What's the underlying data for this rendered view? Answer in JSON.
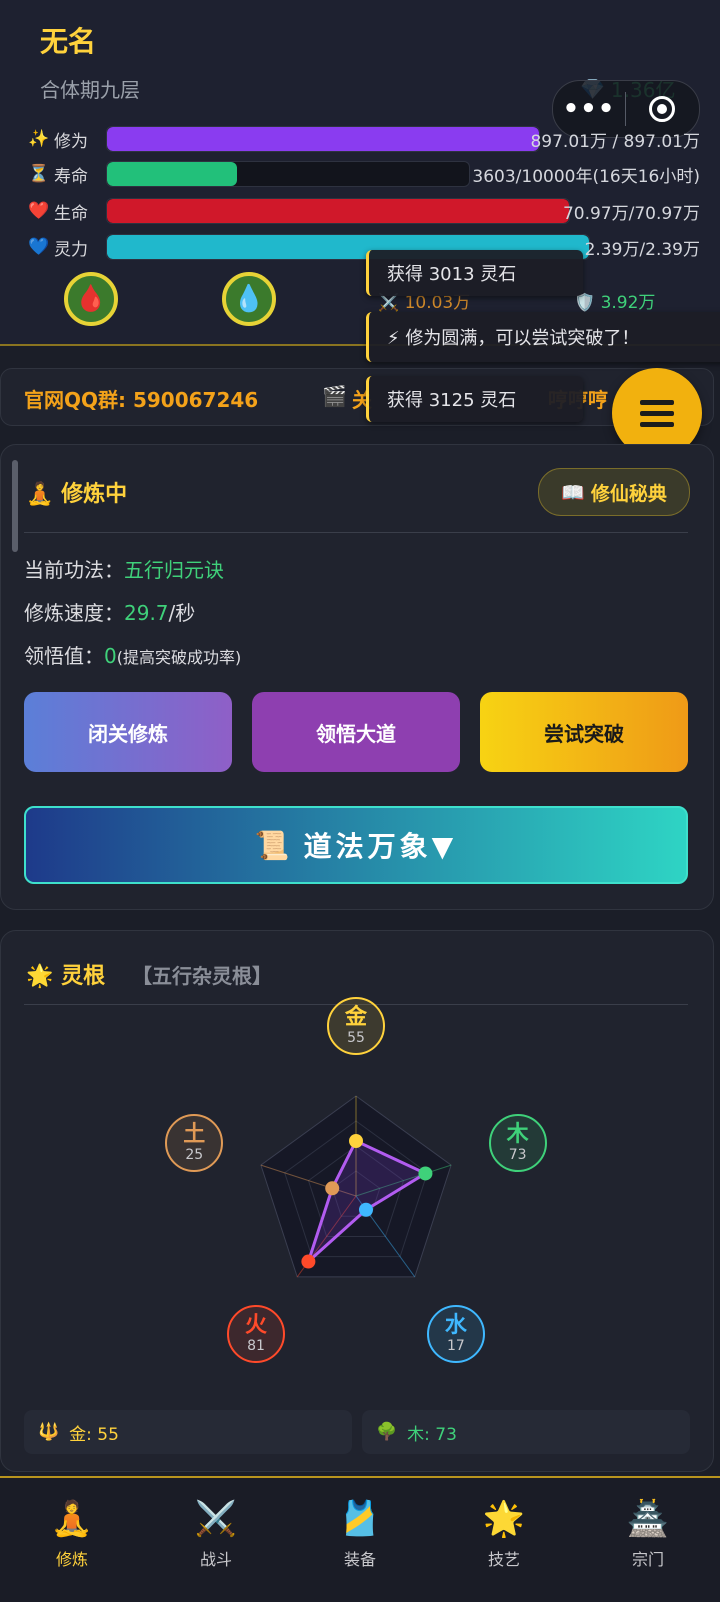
{
  "player": {
    "name": "无名",
    "realm": "合体期九层",
    "spirit_stones": "1.36亿"
  },
  "stats": [
    {
      "icon": "✨",
      "label": "修为",
      "value": "897.01万 / 897.01万",
      "fill": 1.0,
      "color": "#8a3cf0"
    },
    {
      "icon": "⏳",
      "label": "寿命",
      "value": "3603/10000年(16天16小时)",
      "fill": 0.36,
      "color": "#22c07a"
    },
    {
      "icon": "❤️",
      "label": "生命",
      "value": "70.97万/70.97万",
      "fill": 1.0,
      "color": "#d0182a"
    },
    {
      "icon": "💙",
      "label": "灵力",
      "value": "2.39万/2.39万",
      "fill": 1.0,
      "color": "#20b8cc"
    }
  ],
  "combat": {
    "attack": "10.03万",
    "defense": "3.92万"
  },
  "toasts": [
    "获得 3013 灵石",
    "⚡ 修为圆满，可以尝试突破了！",
    "获得 3125 灵石"
  ],
  "qq_bar": {
    "text": "官网QQ群: 590067246",
    "icon": "🎬",
    "mid": "关",
    "right": "哼哼哼"
  },
  "cultivation": {
    "title": "修炼中",
    "manual_button": "修仙秘典",
    "technique_label": "当前功法：",
    "technique": "五行归元诀",
    "speed_label": "修炼速度：",
    "speed": "29.7",
    "speed_unit": "/秒",
    "insight_label": "领悟值：",
    "insight": "0",
    "insight_note": "(提高突破成功率)",
    "buttons": [
      "闭关修炼",
      "领悟大道",
      "尝试突破"
    ],
    "dao_button": "道法万象▼"
  },
  "spirit_root": {
    "title": "灵根",
    "subtitle": "【五行杂灵根】",
    "elements": [
      {
        "name": "金",
        "value": 55,
        "color": "#ffd23c"
      },
      {
        "name": "木",
        "value": 73,
        "color": "#3fd17a"
      },
      {
        "name": "水",
        "value": 17,
        "color": "#3fb8ff"
      },
      {
        "name": "火",
        "value": 81,
        "color": "#ff4a2a"
      },
      {
        "name": "土",
        "value": 25,
        "color": "#e09a56"
      }
    ],
    "cells": [
      {
        "icon": "🔱",
        "text": "金: 55"
      },
      {
        "icon": "🌳",
        "text": "木: 73"
      }
    ]
  },
  "nav": [
    {
      "icon": "🧘",
      "label": "修炼",
      "active": true
    },
    {
      "icon": "⚔️",
      "label": "战斗"
    },
    {
      "icon": "🎽",
      "label": "装备"
    },
    {
      "icon": "🌟",
      "label": "技艺"
    },
    {
      "icon": "🏯",
      "label": "宗门"
    }
  ]
}
